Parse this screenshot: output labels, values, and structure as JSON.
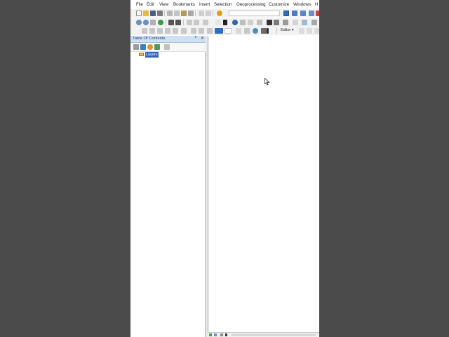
{
  "menu": {
    "items": [
      "File",
      "Edit",
      "View",
      "Bookmarks",
      "Insert",
      "Selection",
      "Geoprocessing",
      "Customize",
      "Windows",
      "H"
    ]
  },
  "toolbar": {
    "scale_value": "",
    "editor_label": "Editor"
  },
  "toc": {
    "title": "Table Of Contents",
    "pin_glyph": "ᵖ",
    "close_glyph": "✕",
    "layers_label": "Layers"
  },
  "colors": {
    "window_bg": "#4b4b4b",
    "toolbar_bg": "#f2f2f2",
    "toc_header": "#cfe0f3",
    "selection_blue": "#2f66b5"
  }
}
